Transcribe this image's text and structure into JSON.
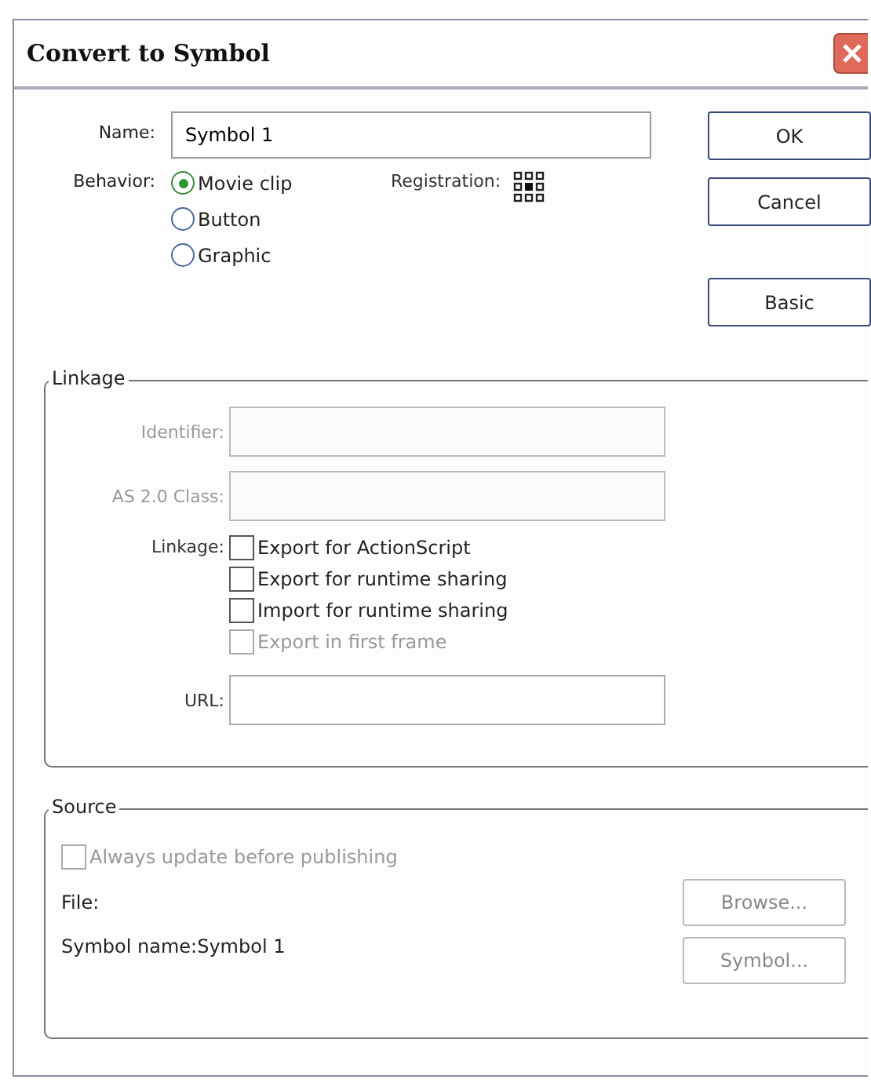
{
  "window": {
    "title": "Convert to Symbol"
  },
  "name_field": {
    "label": "Name:",
    "value": "Symbol 1"
  },
  "behavior": {
    "label": "Behavior:",
    "options": [
      {
        "label": "Movie clip",
        "selected": true
      },
      {
        "label": "Button",
        "selected": false
      },
      {
        "label": "Graphic",
        "selected": false
      }
    ]
  },
  "registration": {
    "label": "Registration:"
  },
  "buttons": [
    {
      "label": "OK"
    },
    {
      "label": "Cancel"
    },
    {
      "label": "Basic"
    }
  ],
  "linkage": {
    "title": "Linkage",
    "fields": [
      {
        "label": "Identifier:",
        "disabled": true
      },
      {
        "label": "AS 2.0 Class:",
        "disabled": true
      }
    ],
    "checkbox_label": "Linkage:",
    "checkboxes": [
      {
        "label": "Export for ActionScript",
        "checked": false,
        "disabled": false
      },
      {
        "label": "Export for runtime sharing",
        "checked": false,
        "disabled": false
      },
      {
        "label": "Import for runtime sharing",
        "checked": false,
        "disabled": false
      },
      {
        "label": "Export in first frame",
        "checked": false,
        "disabled": true
      }
    ],
    "url": {
      "label": "URL:",
      "disabled": false
    }
  },
  "source": {
    "title": "Source",
    "checkbox": {
      "label": "Always update before publishing",
      "checked": false,
      "disabled": true
    },
    "file_label": "File:",
    "symbol_name": "Symbol name:Symbol 1",
    "buttons": [
      {
        "label": "Browse...",
        "disabled": true
      },
      {
        "label": "Symbol...",
        "disabled": true
      }
    ]
  }
}
